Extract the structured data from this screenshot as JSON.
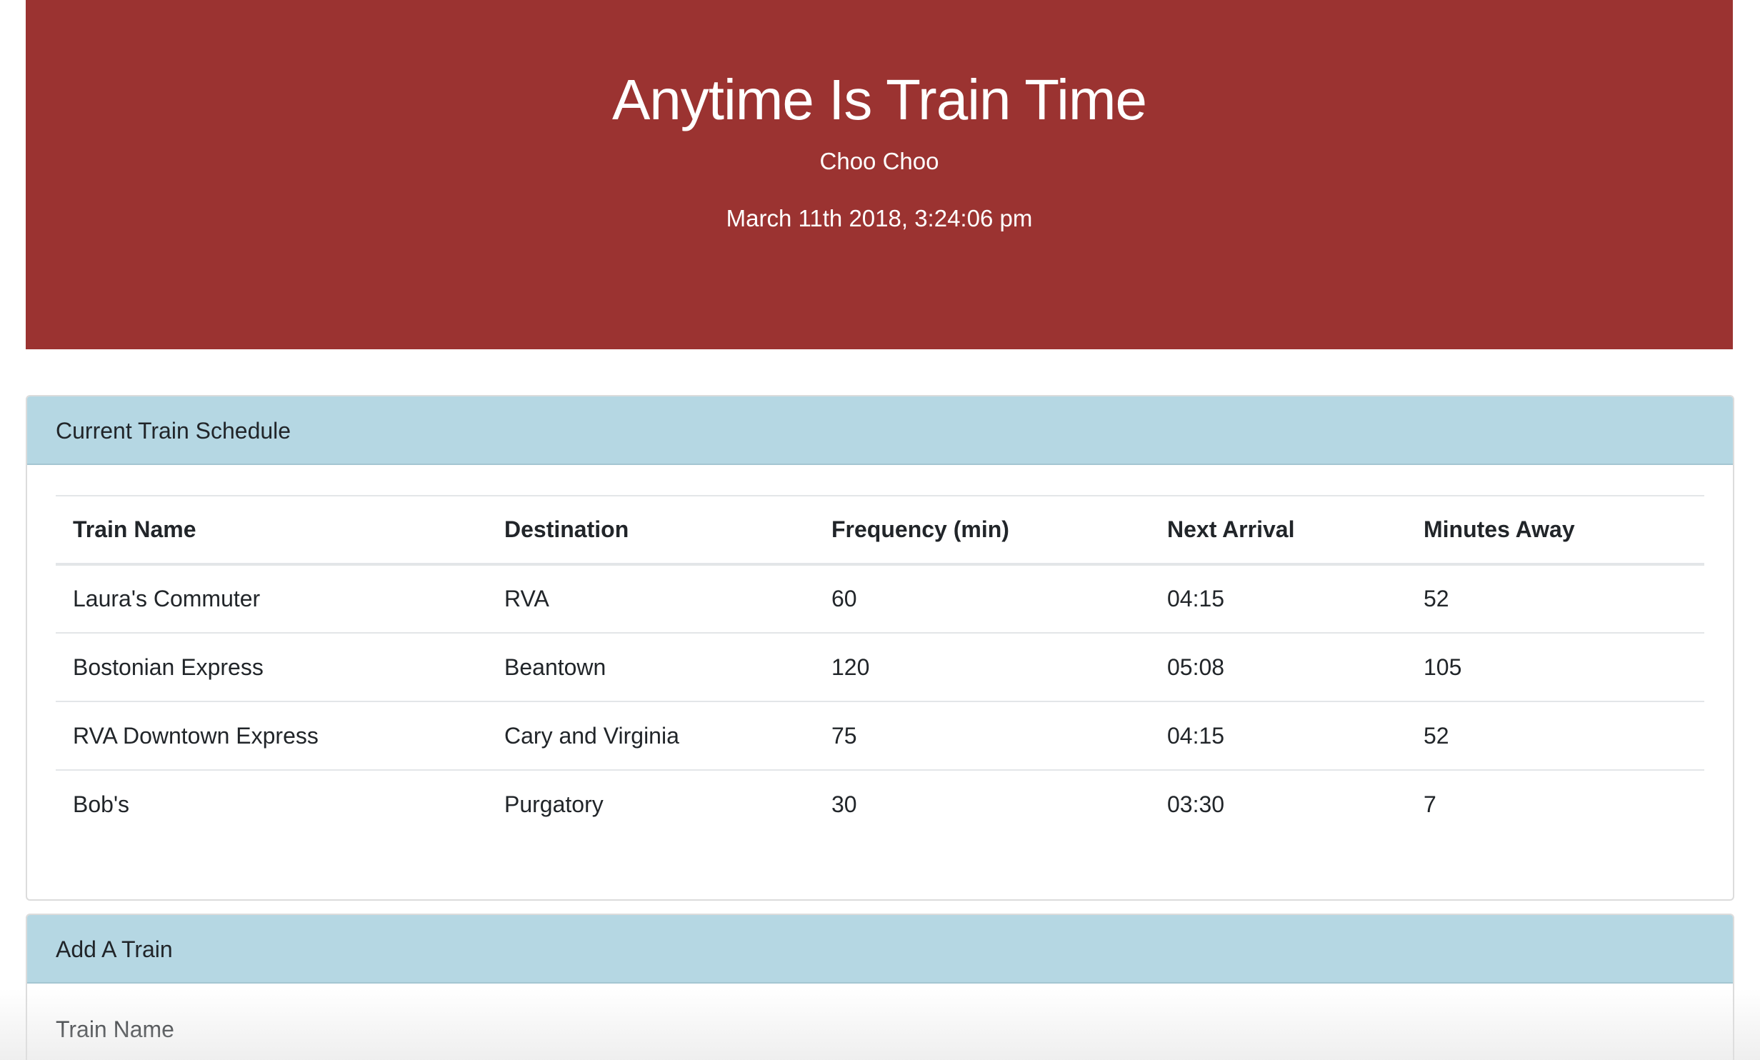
{
  "header": {
    "title": "Anytime Is Train Time",
    "subtitle": "Choo Choo",
    "datetime": "March 11th 2018, 3:24:06 pm",
    "background_color": "#9b3331"
  },
  "schedule": {
    "heading": "Current Train Schedule",
    "header_color": "#b5d7e3",
    "columns": [
      "Train Name",
      "Destination",
      "Frequency (min)",
      "Next Arrival",
      "Minutes Away"
    ],
    "rows": [
      [
        "Laura's Commuter",
        "RVA",
        "60",
        "04:15",
        "52"
      ],
      [
        "Bostonian Express",
        "Beantown",
        "120",
        "05:08",
        "105"
      ],
      [
        "RVA Downtown Express",
        "Cary and Virginia",
        "75",
        "04:15",
        "52"
      ],
      [
        "Bob's",
        "Purgatory",
        "30",
        "03:30",
        "7"
      ]
    ]
  },
  "add_train": {
    "heading": "Add A Train",
    "train_name_label": "Train Name"
  }
}
